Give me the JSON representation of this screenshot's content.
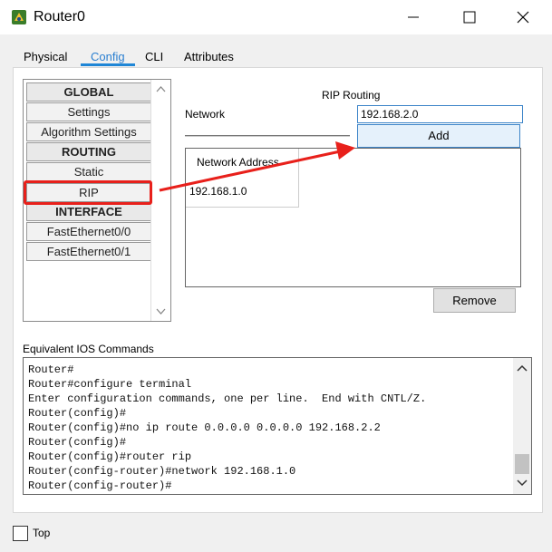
{
  "window": {
    "title": "Router0",
    "icon": "router-app-icon",
    "controls": [
      "minimize-icon",
      "maximize-icon",
      "close-icon"
    ]
  },
  "tabs": [
    {
      "label": "Physical",
      "active": false
    },
    {
      "label": "Config",
      "active": true
    },
    {
      "label": "CLI",
      "active": false
    },
    {
      "label": "Attributes",
      "active": false
    }
  ],
  "sidebar": {
    "items": [
      {
        "label": "GLOBAL",
        "header": true
      },
      {
        "label": "Settings",
        "header": false
      },
      {
        "label": "Algorithm Settings",
        "header": false
      },
      {
        "label": "ROUTING",
        "header": true
      },
      {
        "label": "Static",
        "header": false
      },
      {
        "label": "RIP",
        "header": false,
        "selected": true
      },
      {
        "label": "INTERFACE",
        "header": true
      },
      {
        "label": "FastEthernet0/0",
        "header": false
      },
      {
        "label": "FastEthernet0/1",
        "header": false
      }
    ]
  },
  "rip": {
    "title": "RIP Routing",
    "network_label": "Network",
    "network_value": "192.168.2.0",
    "add_label": "Add",
    "column_header": "Network Address",
    "networks": [
      "192.168.1.0"
    ],
    "remove_label": "Remove"
  },
  "ios": {
    "label": "Equivalent IOS Commands",
    "lines": [
      "Router#",
      "Router#configure terminal",
      "Enter configuration commands, one per line.  End with CNTL/Z.",
      "Router(config)#",
      "Router(config)#no ip route 0.0.0.0 0.0.0.0 192.168.2.2",
      "Router(config)#",
      "Router(config)#router rip",
      "Router(config-router)#network 192.168.1.0",
      "Router(config-router)#"
    ]
  },
  "footer": {
    "top_label": "Top",
    "top_checked": false
  },
  "colors": {
    "accent": "#1f86d6",
    "annotation_red": "#e8201b"
  }
}
